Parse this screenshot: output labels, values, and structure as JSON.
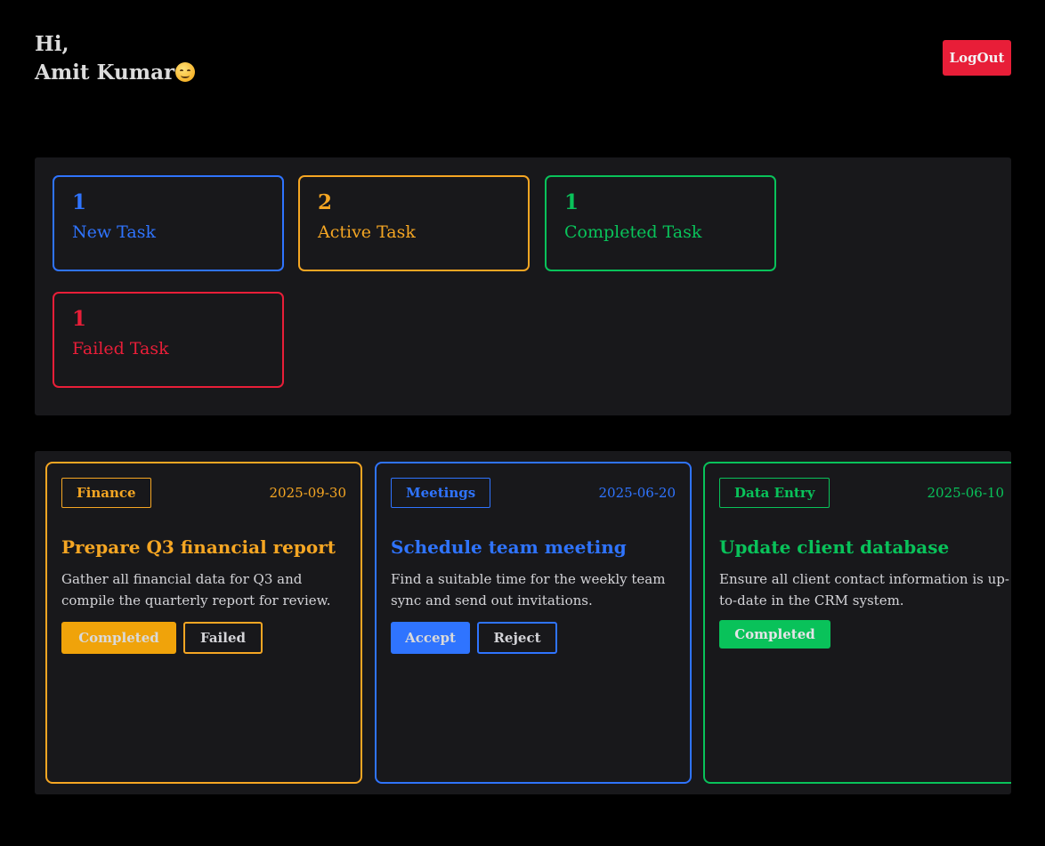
{
  "header": {
    "greeting_line1": "Hi,",
    "user_name": "Amit Kumar",
    "logout_label": "LogOut"
  },
  "stats": [
    {
      "count": "1",
      "label": "New Task",
      "color": "#2f74ff"
    },
    {
      "count": "2",
      "label": "Active Task",
      "color": "#f5a623"
    },
    {
      "count": "1",
      "label": "Completed Task",
      "color": "#09c25a"
    },
    {
      "count": "1",
      "label": "Failed Task",
      "color": "#e81e38"
    }
  ],
  "tasks": [
    {
      "category": "Finance",
      "date": "2025-09-30",
      "title": "Prepare Q3 financial report",
      "description": "Gather all financial data for Q3 and compile the quarterly report for review.",
      "color": "#f5a623",
      "buttons": [
        "Completed",
        "Failed"
      ]
    },
    {
      "category": "Meetings",
      "date": "2025-06-20",
      "title": "Schedule team meeting",
      "description": "Find a suitable time for the weekly team sync and send out invitations.",
      "color": "#2f74ff",
      "buttons": [
        "Accept",
        "Reject"
      ]
    },
    {
      "category": "Data Entry",
      "date": "2025-06-10",
      "title": "Update client database",
      "description": "Ensure all client contact information is up-to-date in the CRM system.",
      "color": "#09c25a",
      "buttons": [
        "Completed"
      ]
    }
  ]
}
